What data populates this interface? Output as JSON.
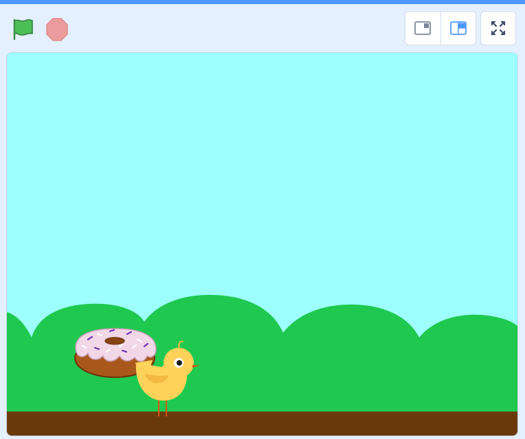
{
  "window": {
    "accent_color": "#4c97ff",
    "background_color": "#e5f0ff"
  },
  "controls": {
    "green_flag": {
      "icon": "green-flag-icon",
      "color": "#4cbf56"
    },
    "stop": {
      "icon": "stop-sign-icon",
      "color": "#ec9c9c"
    },
    "layout_small_stage": {
      "icon": "small-stage-icon",
      "selected": false
    },
    "layout_normal_stage": {
      "icon": "normal-stage-icon",
      "selected": true,
      "color": "#4c97ff"
    },
    "fullscreen": {
      "icon": "fullscreen-icon"
    }
  },
  "stage": {
    "backdrop": {
      "sky_color": "#9effff",
      "hills_color": "#1fc94f",
      "ground_color": "#6b3a0b"
    },
    "sprites": [
      {
        "name": "donut",
        "icon": "donut-sprite"
      },
      {
        "name": "chick",
        "icon": "chick-sprite"
      }
    ]
  }
}
